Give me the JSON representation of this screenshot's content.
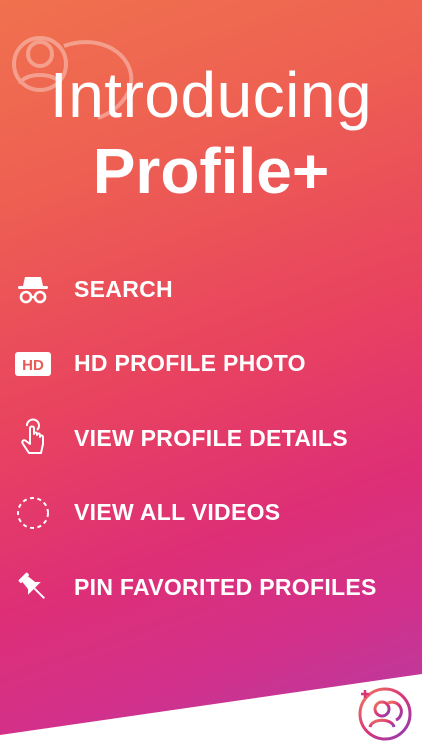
{
  "header": {
    "title_line1": "Introducing",
    "title_line2": "Profile+"
  },
  "features": [
    {
      "label": "SEARCH",
      "icon": "incognito-icon"
    },
    {
      "label": "HD PROFILE PHOTO",
      "icon": "hd-icon"
    },
    {
      "label": "VIEW PROFILE DETAILS",
      "icon": "tap-finger-icon"
    },
    {
      "label": "VIEW ALL VIDEOS",
      "icon": "dashed-circle-icon"
    },
    {
      "label": "PIN FAVORITED PROFILES",
      "icon": "pin-icon"
    }
  ],
  "colors": {
    "gradient_top": "#f0714e",
    "gradient_mid": "#e8435f",
    "gradient_bottom": "#b13ea6",
    "text": "#ffffff",
    "band": "#ffffff",
    "logo_accent": "#c13aa0"
  }
}
